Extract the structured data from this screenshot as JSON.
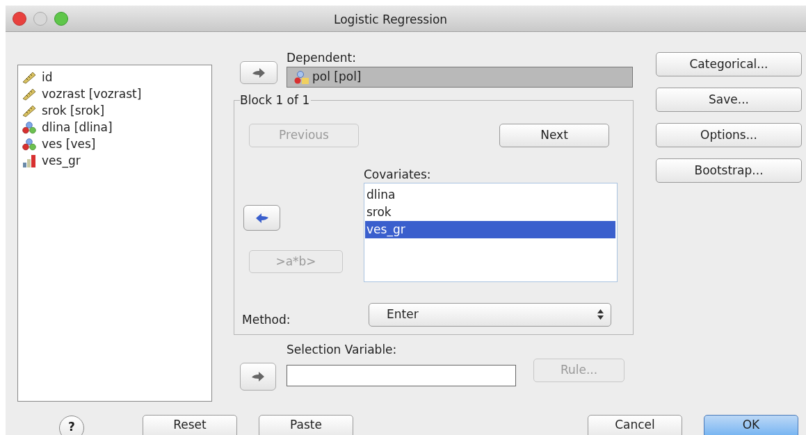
{
  "window": {
    "title": "Logistic Regression"
  },
  "variables": [
    {
      "label": "id",
      "kind": "scale"
    },
    {
      "label": "vozrast [vozrast]",
      "kind": "scale"
    },
    {
      "label": "srok [srok]",
      "kind": "scale"
    },
    {
      "label": "dlina [dlina]",
      "kind": "nominal"
    },
    {
      "label": "ves [ves]",
      "kind": "nominal"
    },
    {
      "label": "ves_gr",
      "kind": "ordinal"
    }
  ],
  "dependent": {
    "label": "Dependent:",
    "value": "pol [pol]",
    "kind": "string"
  },
  "block": {
    "title": "Block 1 of 1",
    "previous": {
      "label": "Previous",
      "disabled": true
    },
    "next": {
      "label": "Next",
      "disabled": false
    },
    "covariates_label": "Covariates:",
    "covariates": [
      {
        "label": "dlina",
        "selected": false
      },
      {
        "label": "srok",
        "selected": false
      },
      {
        "label": "ves_gr",
        "selected": true
      }
    ],
    "interaction_button": {
      "label": ">a*b>",
      "disabled": true
    },
    "method_label": "Method:",
    "method": "Enter"
  },
  "selection_variable": {
    "label": "Selection Variable:",
    "rule_button": {
      "label": "Rule...",
      "disabled": true
    }
  },
  "side_buttons": [
    "Categorical...",
    "Save...",
    "Options...",
    "Bootstrap..."
  ],
  "help": "?",
  "footer_buttons": [
    {
      "label": "Reset",
      "default": false
    },
    {
      "label": "Paste",
      "default": false
    },
    {
      "label": "Cancel",
      "default": false
    },
    {
      "label": "OK",
      "default": true
    }
  ]
}
